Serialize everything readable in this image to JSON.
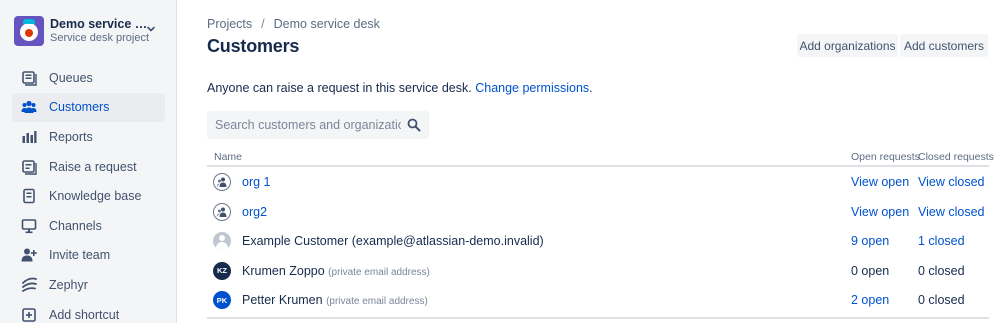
{
  "project": {
    "name": "Demo service desk",
    "type": "Service desk project"
  },
  "nav": {
    "items": [
      {
        "label": "Queues",
        "icon": "queues-icon",
        "active": false
      },
      {
        "label": "Customers",
        "icon": "customers-icon",
        "active": true
      },
      {
        "label": "Reports",
        "icon": "reports-icon",
        "active": false
      },
      {
        "label": "Raise a request",
        "icon": "raise-request-icon",
        "active": false
      },
      {
        "label": "Knowledge base",
        "icon": "knowledge-base-icon",
        "active": false
      },
      {
        "label": "Channels",
        "icon": "channels-icon",
        "active": false
      },
      {
        "label": "Invite team",
        "icon": "invite-team-icon",
        "active": false
      },
      {
        "label": "Zephyr",
        "icon": "zephyr-icon",
        "active": false
      },
      {
        "label": "Add shortcut",
        "icon": "add-shortcut-icon",
        "active": false
      }
    ]
  },
  "breadcrumb": {
    "projects": "Projects",
    "separator": "/",
    "current": "Demo service desk"
  },
  "page": {
    "title": "Customers"
  },
  "actions": {
    "add_organizations": "Add organizations",
    "add_customers": "Add customers"
  },
  "permissions": {
    "text": "Anyone can raise a request in this service desk.",
    "link": "Change permissions",
    "suffix": "."
  },
  "search": {
    "placeholder": "Search customers and organizations"
  },
  "table": {
    "headers": {
      "name": "Name",
      "open": "Open requests",
      "closed": "Closed requests"
    },
    "rows": [
      {
        "type": "organization",
        "name": "org 1",
        "note": "",
        "open": "View open",
        "closed": "View closed",
        "open_link": true,
        "closed_link": true
      },
      {
        "type": "organization",
        "name": "org2",
        "note": "",
        "open": "View open",
        "closed": "View closed",
        "open_link": true,
        "closed_link": true
      },
      {
        "type": "customer",
        "name": "Example Customer (example@atlassian-demo.invalid)",
        "note": "",
        "open": "9 open",
        "closed": "1 closed",
        "open_link": true,
        "closed_link": true
      },
      {
        "type": "customer",
        "name": "Krumen Zoppo",
        "note": "(private email address)",
        "initials": "KZ",
        "avatar_color": "#172b4d",
        "open": "0 open",
        "closed": "0 closed",
        "open_link": false,
        "closed_link": false
      },
      {
        "type": "customer",
        "name": "Petter Krumen",
        "note": "(private email address)",
        "initials": "PK",
        "avatar_color": "#0052cc",
        "open": "2 open",
        "closed": "0 closed",
        "open_link": true,
        "closed_link": false
      }
    ]
  },
  "colors": {
    "accent": "#0052cc",
    "sidebar_bg": "#f4f5f7",
    "project_avatar": "#6554c0"
  }
}
